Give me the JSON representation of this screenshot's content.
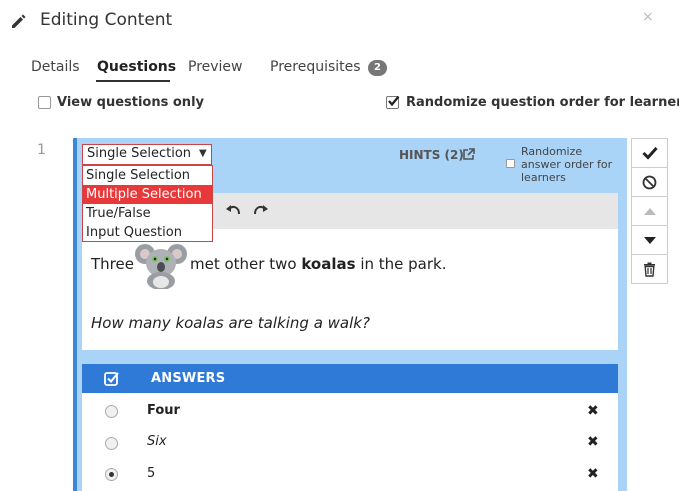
{
  "header": {
    "title": "Editing Content",
    "close_glyph": "×",
    "edit_icon": "pencil-icon"
  },
  "tabs": [
    {
      "label": "Details",
      "active": false
    },
    {
      "label": "Questions",
      "active": true
    },
    {
      "label": "Preview",
      "active": false
    },
    {
      "label": "Prerequisites",
      "active": false,
      "badge": "2"
    }
  ],
  "options": {
    "view_questions_only": {
      "label": "View questions only",
      "checked": false
    },
    "randomize_question_order": {
      "label": "Randomize question order for learners",
      "checked": true
    }
  },
  "question": {
    "number": "1",
    "type_select": {
      "selected": "Single Selection",
      "options": [
        "Single Selection",
        "Multiple Selection",
        "True/False",
        "Input Question"
      ],
      "highlighted": "Multiple Selection"
    },
    "hints_label": "HINTS (2)",
    "randomize_answers_label": "Randomize answer order for learners",
    "content": {
      "line1_before": "Three",
      "line1_after": "met other two",
      "line1_bold": "koalas",
      "line1_end": "in the park.",
      "question_text": "How many koalas are talking a walk?"
    },
    "answers_title": "ANSWERS",
    "answers": [
      {
        "text": "Four",
        "style": "bold",
        "selected": false
      },
      {
        "text": "Six",
        "style": "italic",
        "selected": false
      },
      {
        "text": "5",
        "style": "normal",
        "selected": true
      }
    ],
    "remove_glyph": "✖"
  },
  "side_actions": [
    "check-icon",
    "disable-icon",
    "move-up-icon",
    "move-down-icon",
    "trash-icon"
  ],
  "colors": {
    "card_bg": "#a9d3f7",
    "accent_blue": "#2f7ad6",
    "dropdown_highlight": "#e8383a"
  }
}
